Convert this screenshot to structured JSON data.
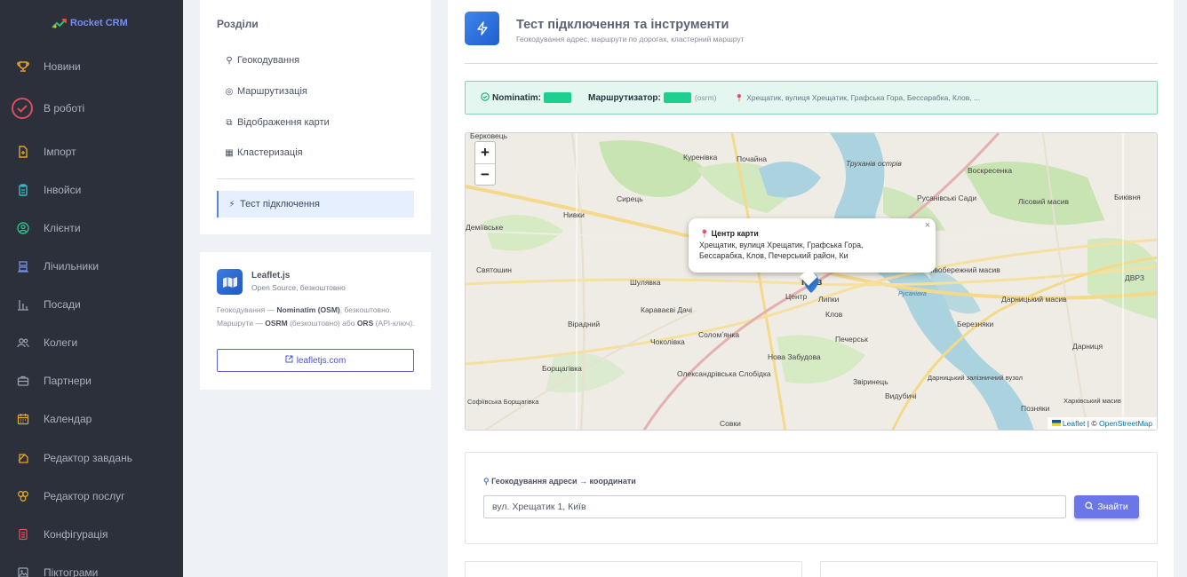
{
  "brand": {
    "name": "Rocket CRM"
  },
  "sidebar": {
    "items": [
      {
        "label": "Новини",
        "icon": "trophy-icon"
      },
      {
        "label": "В роботі",
        "icon": "check-circle-icon"
      },
      {
        "label": "Імпорт",
        "icon": "file-import-icon"
      },
      {
        "label": "Інвойси",
        "icon": "invoice-icon"
      },
      {
        "label": "Клієнти",
        "icon": "user-circle-icon"
      },
      {
        "label": "Лічильники",
        "icon": "counter-icon"
      },
      {
        "label": "Посади",
        "icon": "chart-bar-icon"
      },
      {
        "label": "Колеги",
        "icon": "users-icon"
      },
      {
        "label": "Партнери",
        "icon": "briefcase-icon"
      },
      {
        "label": "Календар",
        "icon": "calendar-icon"
      },
      {
        "label": "Редактор завдань",
        "icon": "task-editor-icon"
      },
      {
        "label": "Редактор послуг",
        "icon": "services-icon"
      },
      {
        "label": "Конфігурація",
        "icon": "config-icon"
      },
      {
        "label": "Піктограми",
        "icon": "pictogram-icon"
      }
    ]
  },
  "sections": {
    "title": "Розділи",
    "items": [
      {
        "label": "Геокодування",
        "icon": "search-icon"
      },
      {
        "label": "Маршрутизація",
        "icon": "map-pin-icon"
      },
      {
        "label": "Відображення карти",
        "icon": "layers-icon"
      },
      {
        "label": "Кластеризація",
        "icon": "cluster-icon"
      }
    ],
    "active_item": {
      "label": "Тест підключення",
      "icon": "bolt-icon"
    }
  },
  "leaflet_card": {
    "name": "Leaflet.js",
    "subtitle": "Open Source, безкоштовно",
    "desc": {
      "p1": "Геокодування — ",
      "b1": "Nominatim (OSM)",
      "p2": ", безкоштовно. Маршрути — ",
      "b2": "OSRM",
      "p3": " (безкоштовно) або ",
      "b3": "ORS",
      "p4": " (API-ключ)."
    },
    "link_label": "leafletjs.com"
  },
  "header": {
    "title": "Тест підключення та інструменти",
    "subtitle": "Геокодування адрес, маршрути по дорогах, кластерний маршрут"
  },
  "status": {
    "nominatim_label": "Nominatim:",
    "router_label": "Маршрутизатор:",
    "router_engine": "(osrm)",
    "location": "Хрещатик, вулиця Хрещатик, Графська Гора, Бессарабка, Клов, ..."
  },
  "map": {
    "zoom_in": "+",
    "zoom_out": "−",
    "popup_title": "Центр карти",
    "popup_address_line1": "Хрещатик, вулиця Хрещатик, Графська Гора,",
    "popup_address_line2": "Бессарабка, Клов, Печерський район, Ки",
    "popup_close": "×",
    "attribution_leaflet": "Leaflet",
    "attribution_sep": " | © ",
    "attribution_osm": "OpenStreetMap",
    "labels": [
      "Берковець",
      "Куренівка",
      "Почайна",
      "Труханів острів",
      "Воскресенка",
      "Сирець",
      "Русанівські Сади",
      "Биківня",
      "Лісовий масив",
      "Нивки",
      "Деміївське",
      "Святошин",
      "Шулявка",
      "Караваєві Дачі",
      "Вірадний",
      "Київ",
      "Центр",
      "Липки",
      "Клов",
      "Лівобережний масив",
      "Соломʼянка",
      "Чоколівка",
      "Печерськ",
      "Березняки",
      "Дарницький масив",
      "Борщагівка",
      "Олександрівська Слобідка",
      "Нова Забудова",
      "Звіринець",
      "Дарницький залізничний вузол",
      "Дарниця",
      "Софіївська Борщагівка",
      "Совки",
      "Видубичі",
      "Позняки",
      "Харківський масив",
      "ДВРЗ",
      "Русанівка"
    ]
  },
  "geocode": {
    "title": "Геокодування адреси → координати",
    "input_value": "вул. Хрещатик 1, Київ",
    "button_label": "Знайти"
  }
}
